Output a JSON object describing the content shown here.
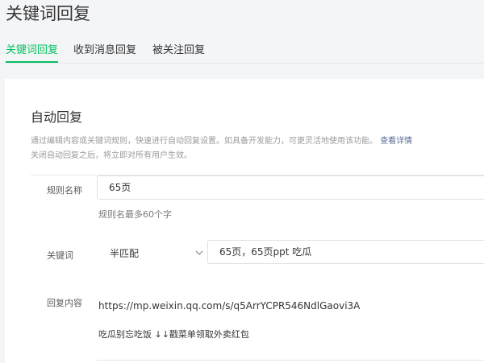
{
  "page": {
    "title": "关键词回复"
  },
  "tabs": [
    {
      "label": "关键词回复",
      "active": true
    },
    {
      "label": "收到消息回复",
      "active": false
    },
    {
      "label": "被关注回复",
      "active": false
    }
  ],
  "auto_reply": {
    "title": "自动回复",
    "description_line1": "通过编辑内容或关键词规则，快速进行自动回复设置。如具备开发能力，可更灵活地使用该功能。",
    "view_details_link": "查看详情",
    "description_line2": "关闭自动回复之后，将立即对所有用户生效。"
  },
  "form": {
    "rule_name": {
      "label": "规则名称",
      "value": "65页",
      "hint": "规则名最多60个字"
    },
    "keyword": {
      "label": "关键词",
      "match_mode": "半匹配",
      "value": "65页，65页ppt 吃瓜"
    },
    "reply": {
      "label": "回复内容",
      "line1": "https://mp.weixin.qq.com/s/q5ArrYCPR546NdlGaovi3A",
      "line2": "吃瓜别忘吃饭 ↓↓戳菜单领取外卖红包"
    }
  },
  "colors": {
    "accent": "#07c160",
    "link": "#576b95"
  }
}
